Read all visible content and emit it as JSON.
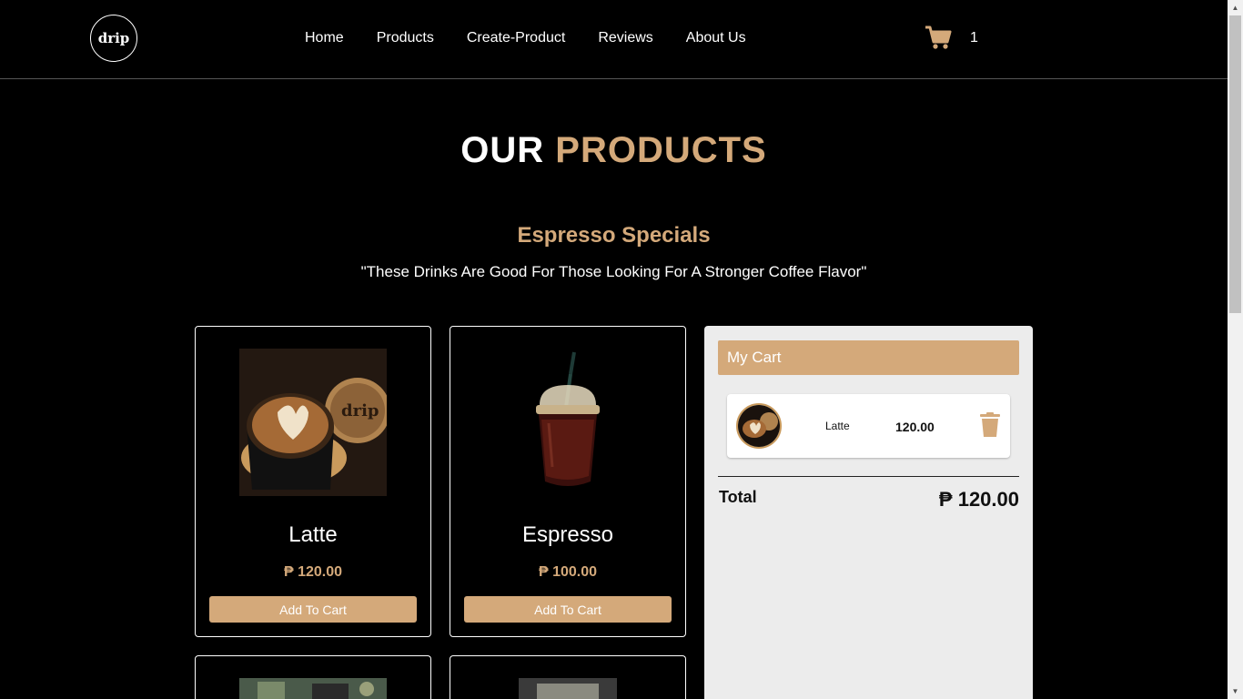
{
  "brand": {
    "logo_text": "drip"
  },
  "nav": {
    "items": [
      {
        "label": "Home"
      },
      {
        "label": "Products"
      },
      {
        "label": "Create-Product"
      },
      {
        "label": "Reviews"
      },
      {
        "label": "About Us"
      }
    ]
  },
  "header_cart": {
    "icon": "shopping-cart-icon",
    "count": "1"
  },
  "page": {
    "title_part1": "OUR",
    "title_part2": "PRODUCTS"
  },
  "category": {
    "title": "Espresso Specials",
    "subtitle": "\"These Drinks Are Good For Those Looking For A Stronger Coffee Flavor\""
  },
  "products": [
    {
      "name": "Latte",
      "price": "₱ 120.00",
      "button": "Add To Cart"
    },
    {
      "name": "Espresso",
      "price": "₱ 100.00",
      "button": "Add To Cart"
    }
  ],
  "cart": {
    "heading": "My Cart",
    "items": [
      {
        "name": "Latte",
        "price": "120.00"
      }
    ],
    "total_label": "Total",
    "total_value": "₱ 120.00"
  },
  "colors": {
    "accent": "#d4a97a",
    "background": "#000000",
    "cart_panel": "#ececec"
  }
}
